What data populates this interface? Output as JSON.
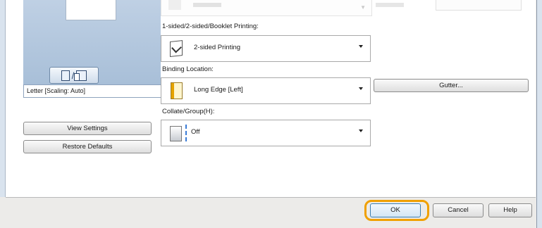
{
  "left_panel": {
    "paper_label": "Letter [Scaling: Auto]",
    "view_settings_label": "View Settings",
    "restore_defaults_label": "Restore Defaults"
  },
  "settings": {
    "printing_label": "1-sided/2-sided/Booklet Printing:",
    "printing_value": "2-sided Printing",
    "binding_label": "Binding Location:",
    "binding_value": "Long Edge [Left]",
    "collate_label": "Collate/Group(H):",
    "collate_value": "Off",
    "gutter_label": "Gutter..."
  },
  "footer": {
    "ok_label": "OK",
    "cancel_label": "Cancel",
    "help_label": "Help"
  },
  "colors": {
    "highlight": "#f0a000",
    "panel": "#bfd0e4"
  }
}
